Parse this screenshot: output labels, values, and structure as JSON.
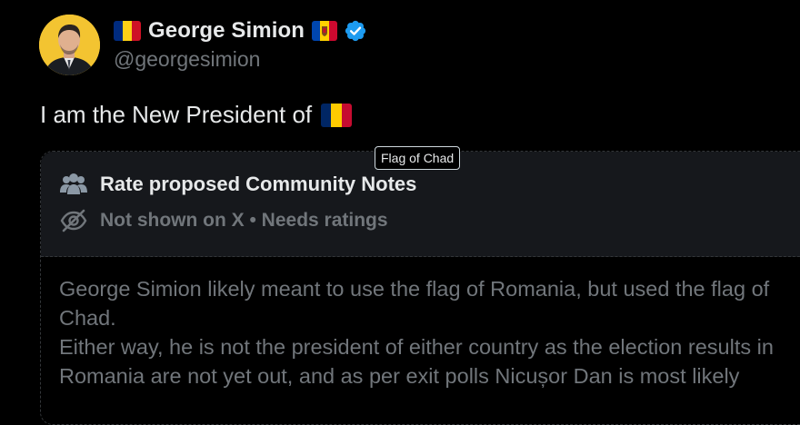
{
  "author": {
    "display_name": "George Simion",
    "handle": "@georgesimion",
    "avatar_icon": "profile-photo",
    "verified_icon": "verified-badge-icon",
    "verified_color": "#1d9bf0",
    "flag_left": {
      "name": "flag-icon",
      "colors": [
        "#002b7f",
        "#fcd116",
        "#ce1126"
      ]
    },
    "flag_right": {
      "name": "moldova-flag-icon",
      "colors": [
        "#0046ae",
        "#ffd200",
        "#cc092f"
      ]
    }
  },
  "tweet": {
    "text": "I am the New President of",
    "flag": {
      "name": "flag-of-chad-icon",
      "colors": [
        "#002664",
        "#fecb00",
        "#c60c30"
      ]
    }
  },
  "tooltip": {
    "text": "Flag of Chad"
  },
  "community_notes": {
    "title": "Rate proposed Community Notes",
    "title_icon": "people-icon",
    "status": "Not shown on X • Needs ratings",
    "status_icon": "eye-slash-icon",
    "body_lines": [
      "George Simion likely meant to use the flag of Romania, but used the flag of",
      "Chad.",
      "Either way, he is not the president of either country as the election results in",
      "Romania are not yet out, and as per exit polls Nicușor Dan is most likely"
    ]
  }
}
